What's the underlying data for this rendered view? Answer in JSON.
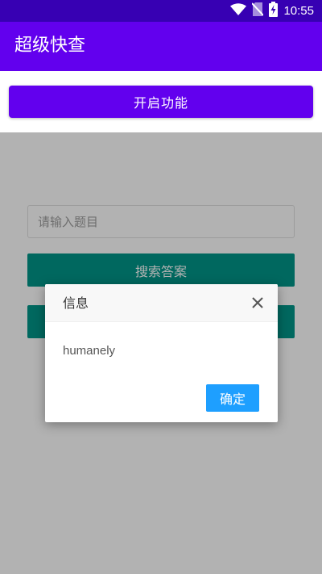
{
  "status_bar": {
    "time": "10:55",
    "icons": [
      "wifi-icon",
      "no-sim-icon",
      "battery-charging-icon"
    ]
  },
  "app_bar": {
    "title": "超级快查"
  },
  "top_panel": {
    "enable_label": "开启功能"
  },
  "form": {
    "question_placeholder": "请输入题目",
    "search_label": "搜索答案",
    "second_label": ""
  },
  "dialog": {
    "title": "信息",
    "message": "humanely",
    "ok_label": "确定",
    "close_icon": "close-icon"
  },
  "colors": {
    "status_bar": "#3700b3",
    "primary": "#6200ee",
    "teal": "#009688",
    "dialog_button": "#1e9fff"
  }
}
